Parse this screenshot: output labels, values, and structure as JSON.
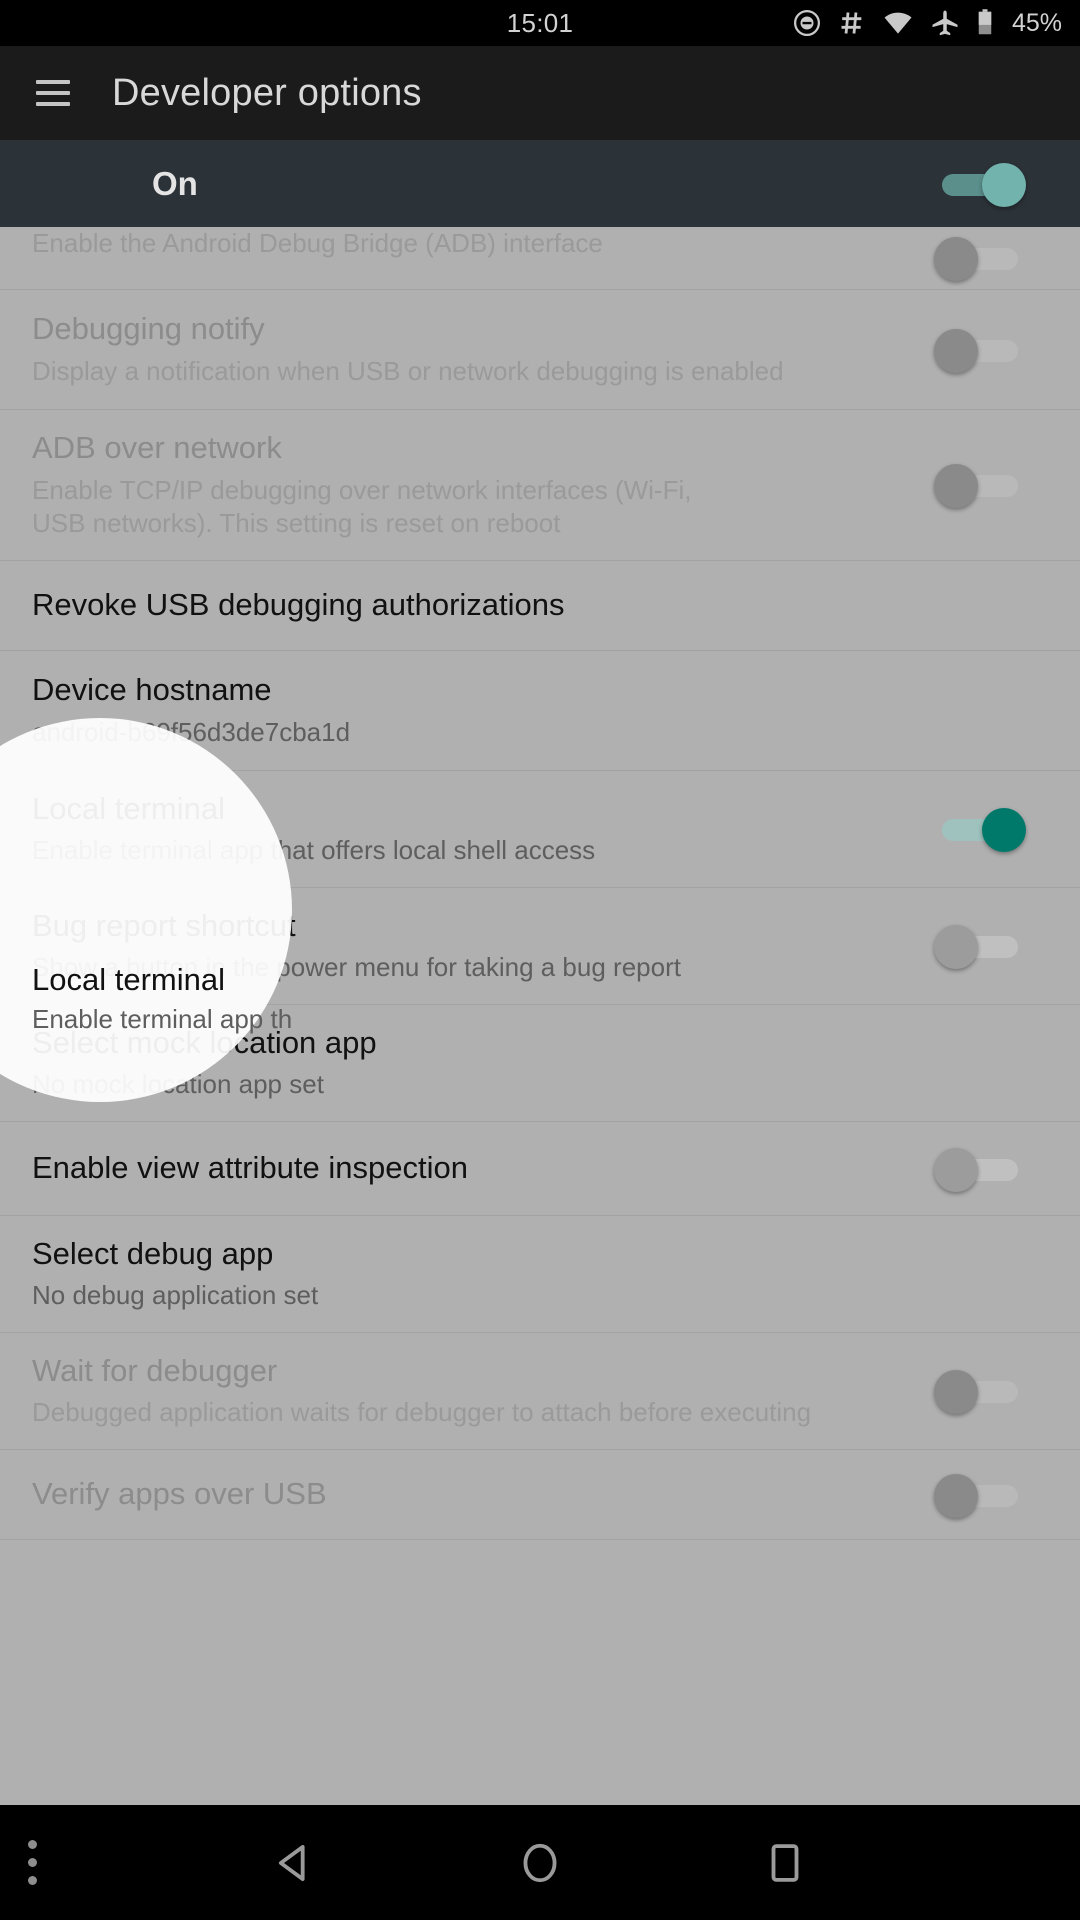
{
  "statusbar": {
    "clock": "15:01",
    "battery_percent": "45%",
    "icons": [
      "do-not-disturb-icon",
      "hash-icon",
      "wifi-icon",
      "airplane-mode-icon",
      "battery-icon"
    ]
  },
  "actionbar": {
    "menu_icon": "hamburger-menu-icon",
    "title": "Developer options"
  },
  "master_switch": {
    "label": "On",
    "state": "on",
    "accent_color": "#73b3ae"
  },
  "list": [
    {
      "name": "adb-interface",
      "title": "",
      "sub": "Enable the Android Debug Bridge (ADB) interface",
      "switch": "off",
      "dim": true
    },
    {
      "name": "debugging-notify",
      "title": "Debugging notify",
      "sub": "Display a notification when USB or network debugging is enabled",
      "switch": "off",
      "dim": true
    },
    {
      "name": "adb-over-network",
      "title": "ADB over network",
      "sub": "Enable TCP/IP debugging over network interfaces (Wi-Fi, USB networks). This setting is reset on reboot",
      "switch": "off",
      "dim": true
    },
    {
      "name": "revoke-usb-debugging-authorizations",
      "title": "Revoke USB debugging authorizations",
      "sub": "",
      "switch": "none",
      "dim": false
    },
    {
      "name": "device-hostname",
      "title": "Device hostname",
      "sub": "android-b69f56d3de7cba1d",
      "switch": "none",
      "dim": false
    },
    {
      "name": "local-terminal",
      "title": "Local terminal",
      "sub": "Enable terminal app that offers local shell access",
      "switch": "on",
      "dim": false
    },
    {
      "name": "bug-report-shortcut",
      "title": "Bug report shortcut",
      "sub": "Show a button in the power menu for taking a bug report",
      "switch": "off",
      "dim": false
    },
    {
      "name": "select-mock-location-app",
      "title": "Select mock location app",
      "sub": "No mock location app set",
      "switch": "none",
      "dim": false
    },
    {
      "name": "enable-view-attribute-inspection",
      "title": "Enable view attribute inspection",
      "sub": "",
      "switch": "off",
      "dim": false
    },
    {
      "name": "select-debug-app",
      "title": "Select debug app",
      "sub": "No debug application set",
      "switch": "none",
      "dim": false
    },
    {
      "name": "wait-for-debugger",
      "title": "Wait for debugger",
      "sub": "Debugged application waits for debugger to attach before executing",
      "switch": "off",
      "dim": true
    },
    {
      "name": "verify-apps-over-usb",
      "title": "Verify apps over USB",
      "sub": "",
      "switch": "off",
      "dim": true
    }
  ],
  "spotlight": {
    "target": "local-terminal",
    "title": "Local terminal",
    "sub": "Enable terminal app that offers local shell access"
  },
  "navbar": {
    "overflow_icon": "overflow-dots-icon",
    "back_icon": "back-triangle-icon",
    "home_icon": "home-circle-icon",
    "recents_icon": "recents-square-icon"
  }
}
